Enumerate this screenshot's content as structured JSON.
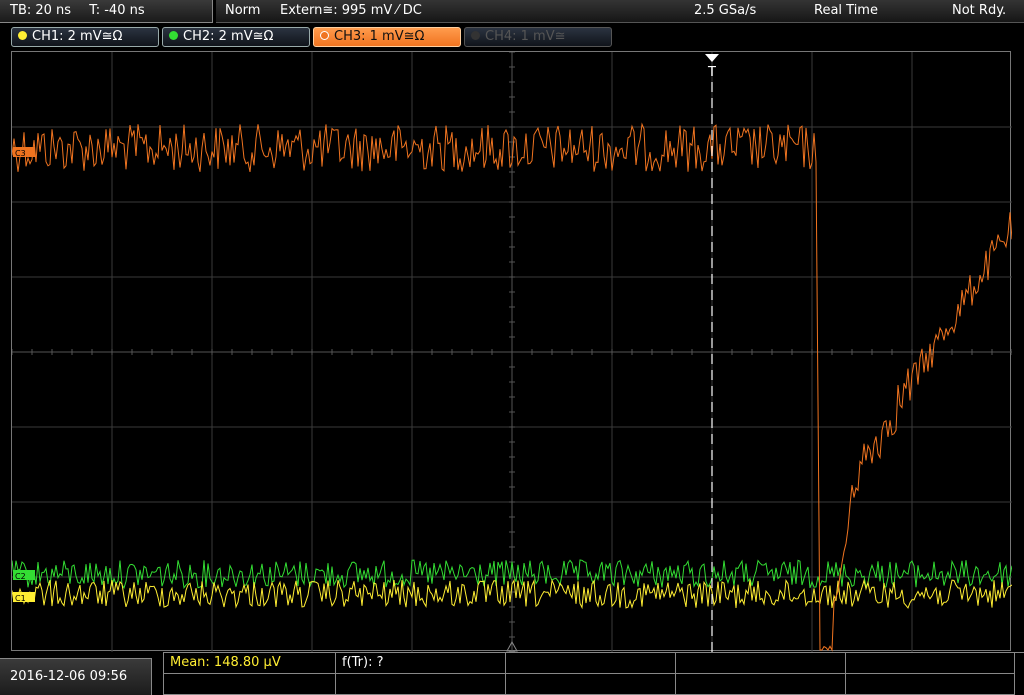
{
  "topbar": {
    "timebase": "TB: 20 ns",
    "trigger_pos": "T: -40 ns",
    "mode": "Norm",
    "trigger": "Extern≅: 995 mV ⁄ DC",
    "sample_rate": "2.5 GSa/s",
    "acq_mode": "Real Time",
    "status": "Not Rdy."
  },
  "channels": [
    {
      "label": "CH1: 2 mV≅Ω",
      "color": "#ffee33",
      "state": "on"
    },
    {
      "label": "CH2: 2 mV≅Ω",
      "color": "#33dd33",
      "state": "on"
    },
    {
      "label": "CH3: 1 mV≅Ω",
      "color": "#f07420",
      "state": "selected"
    },
    {
      "label": "CH4: 1 mV≅",
      "color": "#555555",
      "state": "off"
    }
  ],
  "screen": {
    "trigger_marker": "T",
    "ch3_marker": "C3",
    "ch2_marker": "C2",
    "ch1_marker": "C1"
  },
  "bottom": {
    "datetime": "2016-12-06 09:56",
    "measurement_1": "Mean: 148.80 µV",
    "measurement_2": "f(Tr): ?"
  },
  "colors": {
    "ch1": "#ffee33",
    "ch2": "#33dd33",
    "ch3": "#f07420",
    "grid": "#444444"
  }
}
